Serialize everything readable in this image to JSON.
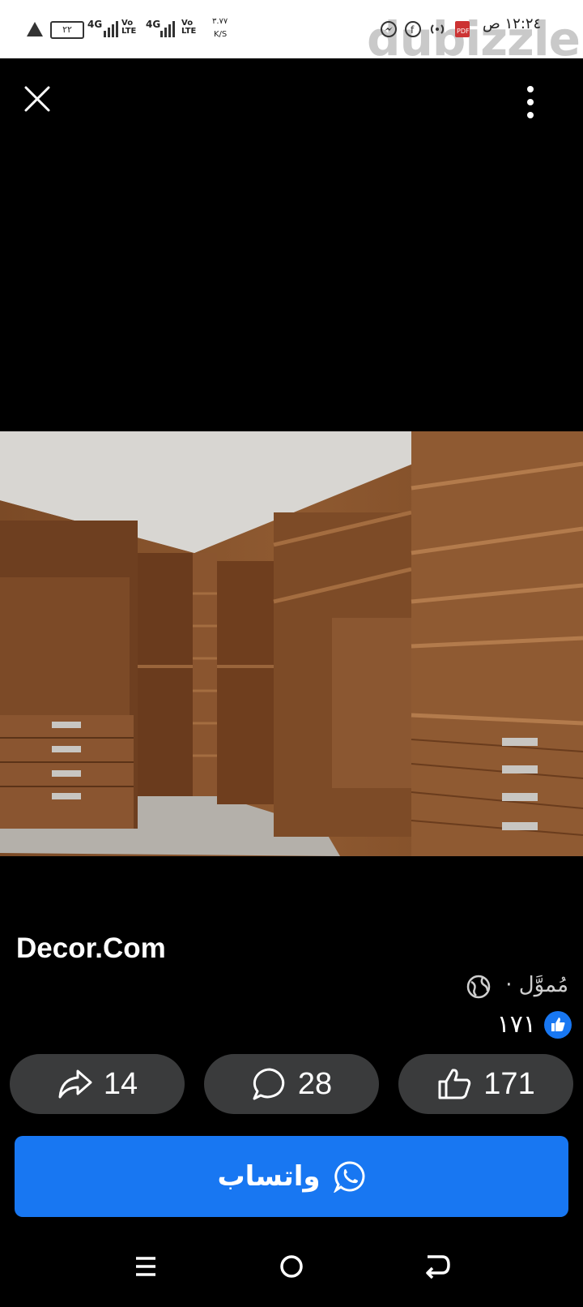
{
  "status_bar": {
    "time": "١٢:٢٤ ص",
    "battery": "٢٢",
    "network_1": "4G",
    "network_2": "4G",
    "volte_1": "Vo\nLTE",
    "volte_2": "Vo\nLTE",
    "speed_value": "٣.٧٧",
    "speed_unit": "K/S"
  },
  "watermark": "dubizzle",
  "post": {
    "page_name": "Decor.Com",
    "sponsored_label": "مُموَّل ·",
    "likes_summary": "١٧١"
  },
  "actions": {
    "share_count": "14",
    "comment_count": "28",
    "like_count": "171"
  },
  "cta": {
    "whatsapp_label": "واتساب"
  },
  "icons": {
    "close": "close-icon",
    "more": "more-vertical-icon",
    "globe": "globe-icon",
    "like_badge": "thumbs-up-icon",
    "share": "share-arrow-icon",
    "comment": "comment-bubble-icon",
    "like": "thumbs-up-outline-icon",
    "whatsapp": "whatsapp-icon"
  },
  "colors": {
    "accent": "#1877f2",
    "pill_bg": "#3a3b3c",
    "background": "#000000"
  }
}
